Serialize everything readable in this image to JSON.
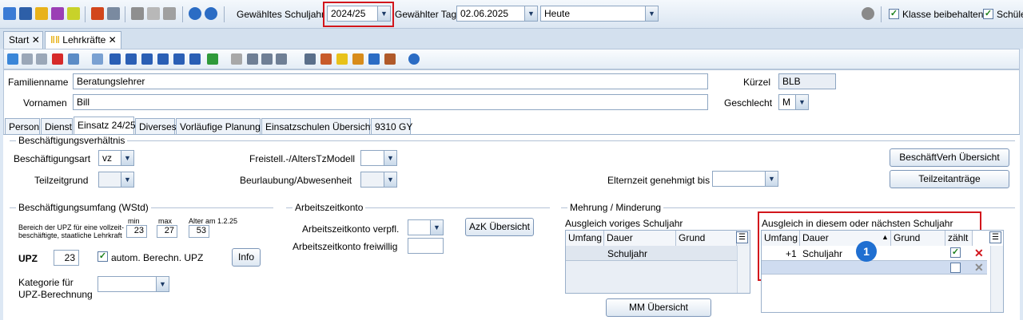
{
  "toolbar": {
    "schuljahr_label": "Gewähltes Schuljahr",
    "schuljahr_value": "2024/25",
    "tag_label": "Gewählter Tag",
    "tag_value": "02.06.2025",
    "heute_value": "Heute",
    "klasse_label": "Klasse beibehalten",
    "schueler_label": "Schüle"
  },
  "tabs": [
    {
      "label": "Start"
    },
    {
      "label": "Lehrkräfte"
    }
  ],
  "form": {
    "familienname_label": "Familienname",
    "familienname_value": "Beratungslehrer",
    "vornamen_label": "Vornamen",
    "vornamen_value": "Bill",
    "kuerzel_label": "Kürzel",
    "kuerzel_value": "BLB",
    "geschlecht_label": "Geschlecht",
    "geschlecht_value": "M"
  },
  "subtabs": [
    "Person",
    "Dienst",
    "Einsatz 24/25",
    "Diverses",
    "Vorläufige Planung",
    "Einsatzschulen Übersicht",
    "9310 GY"
  ],
  "beschaeftigung": {
    "group_title": "Beschäftigungsverhältnis",
    "art_label": "Beschäftigungsart",
    "art_value": "vz",
    "teilzeit_label": "Teilzeitgrund",
    "freistell_label": "Freistell.-/AltersTzModell",
    "beurlaubung_label": "Beurlaubung/Abwesenheit",
    "elternzeit_label": "Elternzeit genehmigt bis",
    "btn_uebersicht": "BeschäftVerh Übersicht",
    "btn_teilzeit": "Teilzeitanträge"
  },
  "umfang": {
    "group_title": "Beschäftigungsumfang (WStd)",
    "bereich_text_1": "Bereich der UPZ für eine vollzeit-",
    "bereich_text_2": "beschäftigte, staatliche Lehrkraft",
    "min_label": "min",
    "min_value": "23",
    "max_label": "max",
    "max_value": "27",
    "alter_label": "Alter am 1.2.25",
    "alter_value": "53",
    "upz_label": "UPZ",
    "upz_value": "23",
    "autom_label": "autom. Berechn. UPZ",
    "info_btn": "Info",
    "kategorie_label_1": "Kategorie für",
    "kategorie_label_2": "UPZ-Berechnung"
  },
  "arbeitszeit": {
    "group_title": "Arbeitszeitkonto",
    "verpfl_label": "Arbeitszeitkonto verpfl.",
    "freiwillig_label": "Arbeitszeitkonto freiwillig",
    "azk_btn": "AzK Übersicht"
  },
  "mehrung": {
    "group_title": "Mehrung / Minderung",
    "voriges_title": "Ausgleich voriges Schuljahr",
    "voriges_cols": [
      "Umfang",
      "Dauer",
      "Grund"
    ],
    "voriges_row_dauer": "Schuljahr",
    "mm_btn": "MM Übersicht",
    "diesem_title": "Ausgleich in diesem oder nächsten Schuljahr",
    "diesem_cols": [
      "Umfang",
      "Dauer",
      "Grund",
      "zählt"
    ],
    "row1_umfang": "+1",
    "row1_dauer": "Schuljahr",
    "badge": "1"
  },
  "colors": {
    "accent": "#1f6fd1",
    "highlight": "#d2161c"
  }
}
